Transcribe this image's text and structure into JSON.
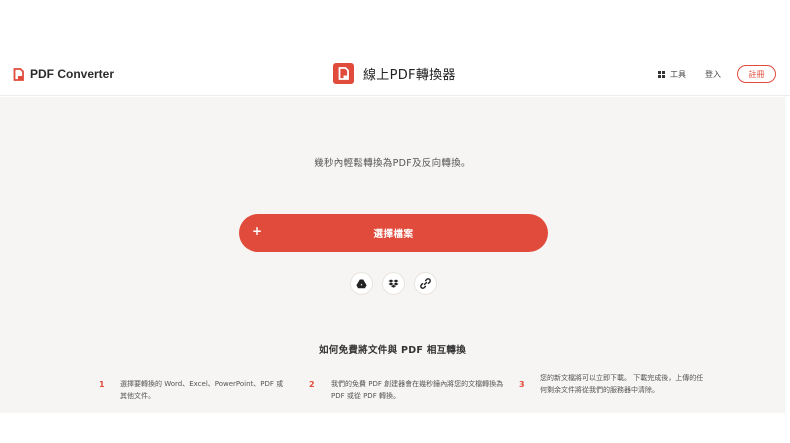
{
  "header": {
    "brand": "PDF Converter",
    "title": "線上PDF轉換器",
    "nav": {
      "tools": "工具",
      "login": "登入",
      "signup": "註冊"
    }
  },
  "main": {
    "subtitle": "幾秒內輕鬆轉換為PDF及反向轉換。",
    "choose_button": {
      "plus": "+",
      "label": "選擇檔案"
    },
    "sources": [
      {
        "icon": "google-drive-icon"
      },
      {
        "icon": "dropbox-icon"
      },
      {
        "icon": "link-icon"
      }
    ]
  },
  "howto": {
    "title": "如何免費將文件與 PDF 相互轉換",
    "steps": [
      {
        "num": "1",
        "text": "選擇要轉換的 Word、Excel、PowerPoint、PDF 或其他文件。"
      },
      {
        "num": "2",
        "text": "我們的免費 PDF 創建器會在幾秒鐘內將您的文檔轉換為 PDF 或從 PDF 轉換。"
      },
      {
        "num": "3",
        "text": "您的新文檔將可以立即下載。 下載完成後，上傳的任何剩余文件將從我們的服務器中清除。"
      }
    ]
  },
  "colors": {
    "accent": "#e04b3c",
    "background": "#f7f5f3"
  }
}
